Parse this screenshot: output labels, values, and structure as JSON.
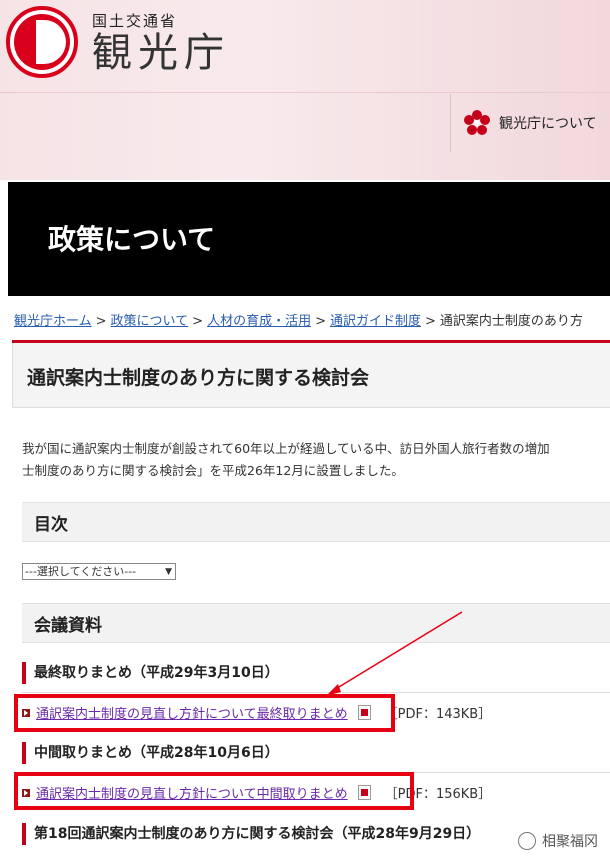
{
  "header": {
    "ministry": "国土交通省",
    "agency": "観光庁",
    "about_link": "観光庁について"
  },
  "hero": {
    "title": "政策について"
  },
  "breadcrumb": {
    "items": [
      "観光庁ホーム",
      "政策について",
      "人材の育成・活用",
      "通訳ガイド制度"
    ],
    "current": "通訳案内士制度のあり方",
    "separator": ">"
  },
  "page": {
    "title": "通訳案内士制度のあり方に関する検討会",
    "intro_line1": "我が国に通訳案内士制度が創設されて60年以上が経過している中、訪日外国人旅行者数の増加",
    "intro_line2": "士制度のあり方に関する検討会」を平成26年12月に設置しました。"
  },
  "toc": {
    "heading": "目次",
    "select_value": "---選択してください---"
  },
  "materials": {
    "heading": "会議資料",
    "groups": [
      {
        "title": "最終取りまとめ（平成29年3月10日）",
        "doc": "通訳案内士制度の見直し方針について最終取りまとめ",
        "size": "［PDF：143KB］"
      },
      {
        "title": "中間取りまとめ（平成28年10月6日）",
        "doc": "通訳案内士制度の見直し方針について中間取りまとめ",
        "size": "［PDF：156KB］"
      },
      {
        "title": "第18回通訳案内士制度のあり方に関する検討会（平成28年9月29日）"
      }
    ]
  },
  "watermark": "相聚福冈",
  "colors": {
    "accent": "#c4001a",
    "highlight": "#e60012",
    "link": "#2a5db0"
  }
}
